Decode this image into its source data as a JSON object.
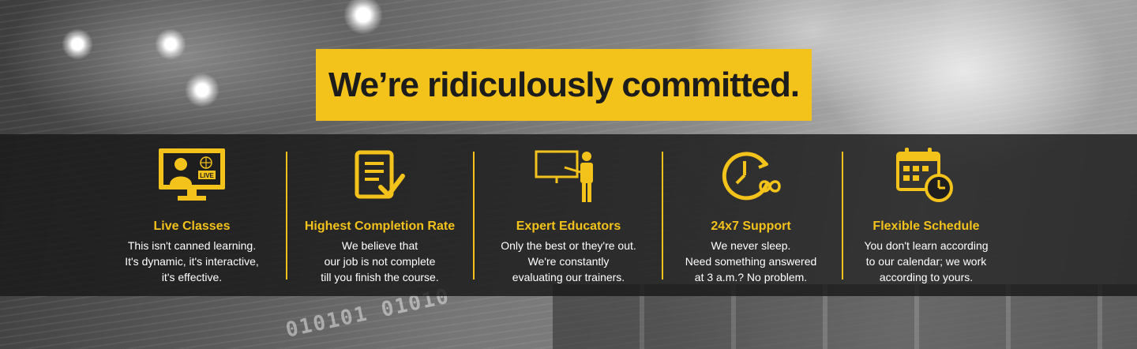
{
  "banner": {
    "title": "We’re ridiculously committed."
  },
  "features": [
    {
      "icon": "live-classes-icon",
      "heading": "Live Classes",
      "description": "This isn't canned learning.\nIt's dynamic, it's interactive,\nit's effective.",
      "badge": "LIVE"
    },
    {
      "icon": "checklist-icon",
      "heading": "Highest Completion Rate",
      "description": "We believe that\nour job is not complete\ntill you finish the course."
    },
    {
      "icon": "educator-icon",
      "heading": "Expert Educators",
      "description": "Only the best or they're out.\nWe're constantly\nevaluating our trainers."
    },
    {
      "icon": "clock-infinity-icon",
      "heading": "24x7 Support",
      "description": "We never sleep.\nNeed something answered\nat 3 a.m.? No problem."
    },
    {
      "icon": "calendar-clock-icon",
      "heading": "Flexible Schedule",
      "description": "You don't learn according\nto our calendar; we work\naccording to yours."
    }
  ],
  "colors": {
    "accent": "#f3c21b",
    "band": "#191919",
    "title_text": "#1c1c1c",
    "description_text": "#ffffff"
  },
  "background_text": "010101 01010"
}
